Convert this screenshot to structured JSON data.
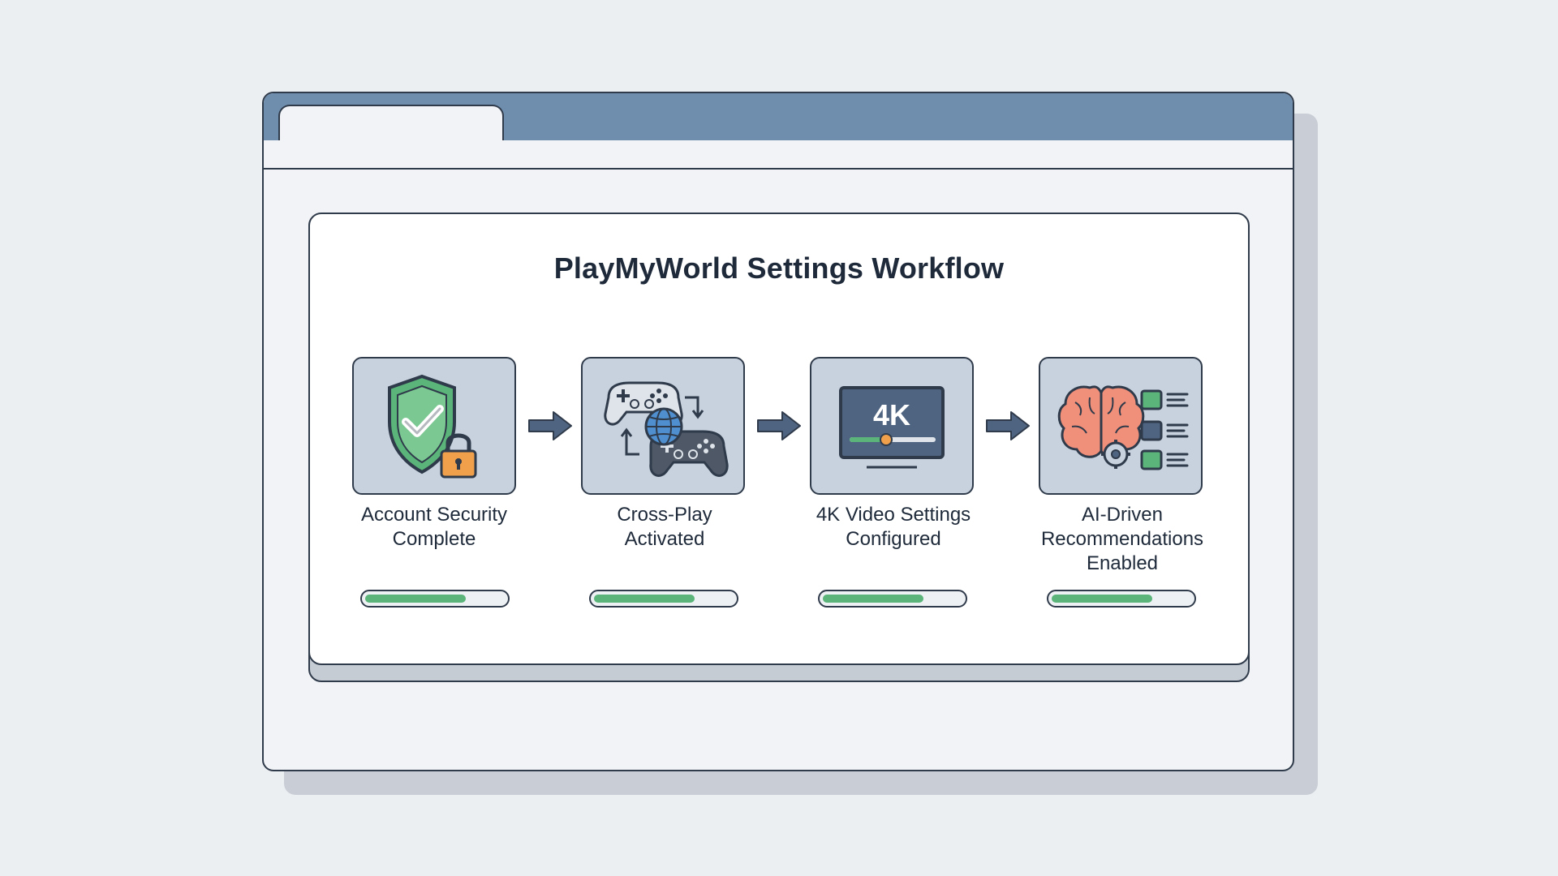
{
  "diagram": {
    "title": "PlayMyWorld Settings Workflow",
    "steps": [
      {
        "label": "Account Security\nComplete",
        "icon": "shield-lock-icon",
        "progress": 0.72
      },
      {
        "label": "Cross-Play\nActivated",
        "icon": "crossplay-controllers-icon",
        "progress": 0.72
      },
      {
        "label": "4K Video Settings\nConfigured",
        "icon": "monitor-4k-icon",
        "icon_text": "4K",
        "progress": 0.72
      },
      {
        "label": "AI-Driven\nRecommendations\nEnabled",
        "icon": "ai-brain-recommendations-icon",
        "progress": 0.72
      }
    ]
  },
  "colors": {
    "titlebar": "#6f8eae",
    "step_box": "#c7d2de",
    "progress": "#5bb57a",
    "shield": "#5bb57a",
    "lock": "#f0a04b",
    "brain": "#f08f7a",
    "outline": "#2f3a4a"
  }
}
